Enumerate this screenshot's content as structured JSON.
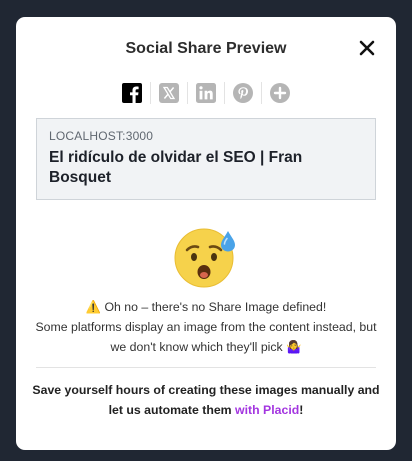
{
  "modal": {
    "title": "Social Share Preview",
    "close_icon": "close-icon"
  },
  "share_icons": [
    {
      "name": "facebook-icon",
      "active": true
    },
    {
      "name": "x-twitter-icon",
      "active": false
    },
    {
      "name": "linkedin-icon",
      "active": false
    },
    {
      "name": "pinterest-icon",
      "active": false
    },
    {
      "name": "add-icon",
      "active": false
    }
  ],
  "preview": {
    "domain": "LOCALHOST:3000",
    "headline": "El ridículo de olvidar el SEO | Fran Bosquet"
  },
  "message": {
    "emoji": "anxious-face-with-sweat",
    "line1": "⚠️ Oh no – there's no Share Image defined!",
    "line2": "Some platforms display an image from the content instead, but",
    "line3": "we don't know which they'll pick 🤷‍♀️"
  },
  "cta": {
    "text_before": "Save yourself hours of creating these images manually and let us automate them ",
    "link_text": "with Placid",
    "text_after": "!"
  },
  "colors": {
    "backdrop": "#202733",
    "accent": "#a335e0",
    "icon_active": "#000000",
    "icon_inactive": "#b5b5b5"
  }
}
